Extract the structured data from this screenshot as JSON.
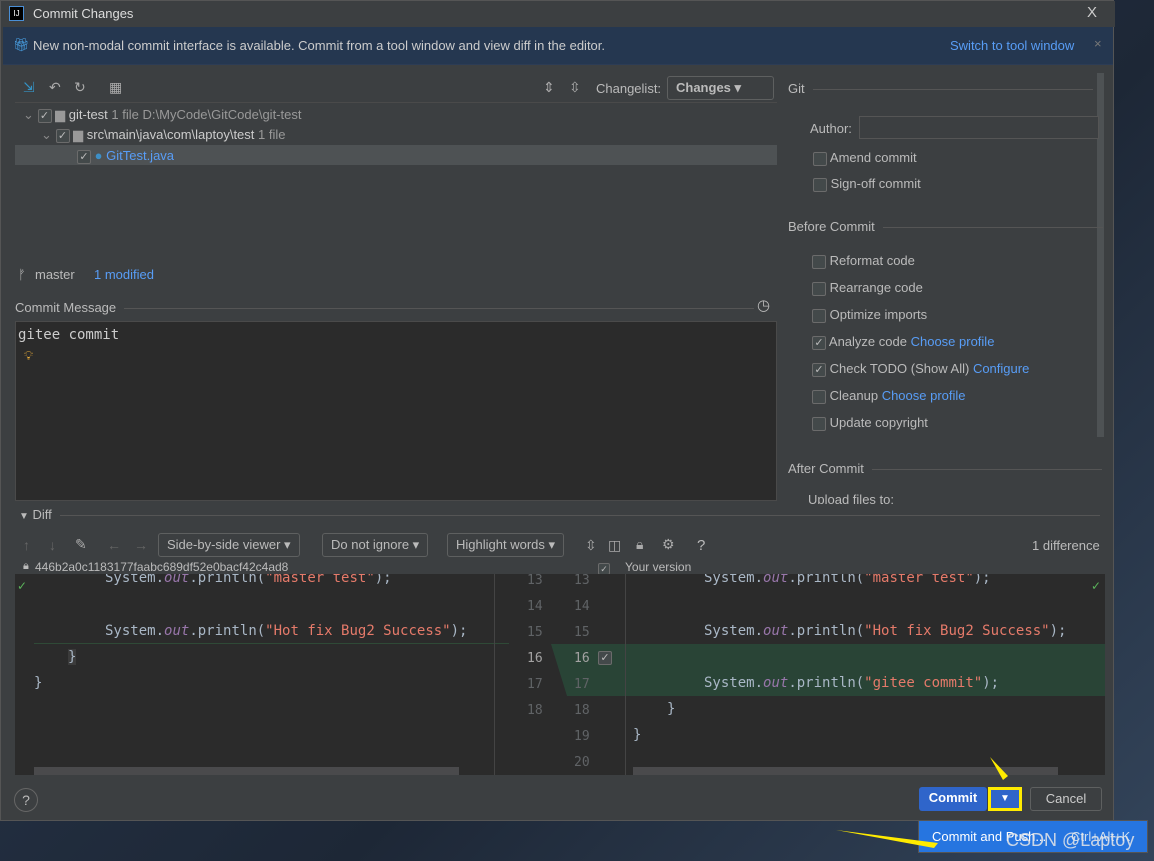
{
  "window": {
    "title": "Commit Changes",
    "close": "X",
    "app_icon": "IJ"
  },
  "banner": {
    "text": "New non-modal commit interface is available. Commit from a tool window and view diff in the editor.",
    "link": "Switch to tool window",
    "close": "×"
  },
  "toolbar": {
    "changelist_label": "Changelist:",
    "changelist_value": "Changes"
  },
  "tree": [
    {
      "name": "git-test",
      "count": "1 file",
      "path": "D:\\MyCode\\GitCode\\git-test"
    },
    {
      "name": "src\\main\\java\\com\\laptoy\\test",
      "count": "1 file"
    },
    {
      "name": "GitTest.java"
    }
  ],
  "status": {
    "branch": "master",
    "modified": "1 modified"
  },
  "commit_message": {
    "label": "Commit Message",
    "value": "gitee commit"
  },
  "git": {
    "section": "Git",
    "author_label": "Author:",
    "author_value": "",
    "amend": "Amend commit",
    "signoff": "Sign-off commit"
  },
  "before_commit": {
    "section": "Before Commit",
    "items": [
      {
        "label": "Reformat code",
        "checked": false
      },
      {
        "label": "Rearrange code",
        "checked": false
      },
      {
        "label": "Optimize imports",
        "checked": false
      },
      {
        "label": "Analyze code",
        "checked": true,
        "link": "Choose profile"
      },
      {
        "label": "Check TODO (Show All)",
        "checked": true,
        "link": "Configure"
      },
      {
        "label": "Cleanup",
        "checked": false,
        "link": "Choose profile"
      },
      {
        "label": "Update copyright",
        "checked": false
      }
    ]
  },
  "after_commit": {
    "section": "After Commit",
    "upload": "Upload files to:"
  },
  "diff": {
    "label": "Diff",
    "viewer": "Side-by-side viewer",
    "ignore": "Do not ignore",
    "highlight": "Highlight words",
    "help": "?",
    "differences": "1 difference",
    "left_hash": "446b2a0c1183177faabc689df52e0bacf42c4ad8",
    "right_label": "Your version",
    "left_lines": [
      "13",
      "14",
      "15",
      "16",
      "17",
      "18"
    ],
    "right_lines": [
      "13",
      "14",
      "15",
      "16",
      "17",
      "18",
      "19",
      "20"
    ]
  },
  "buttons": {
    "commit": "Commit",
    "cancel": "Cancel",
    "help": "?"
  },
  "popup": {
    "item": "Commit and Push...",
    "shortcut": "Ctrl+Alt+K"
  },
  "watermark": "CSDN @Laptoy",
  "colors": {
    "accent": "#365880",
    "primary_button": "#2f65ca",
    "added_bg": "#294436",
    "highlight": "#ffff00"
  }
}
